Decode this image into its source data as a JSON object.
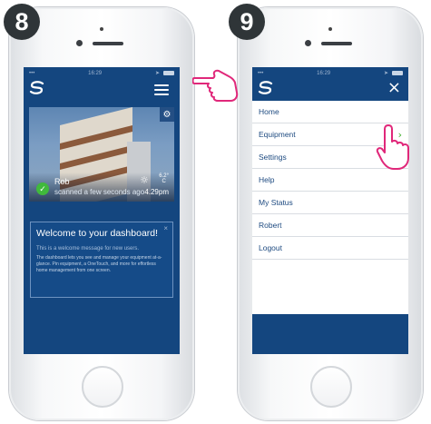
{
  "steps": {
    "left": "8",
    "right": "9"
  },
  "status_bar": {
    "left": "•••",
    "time": "16:29",
    "arrow": "➤"
  },
  "dashboard": {
    "user_name": "Rob",
    "scan_status": "scanned a few seconds ago",
    "temperature": "6.2°",
    "temperature_unit": "C",
    "time": "4.29pm",
    "welcome": {
      "title": "Welcome to your dashboard!",
      "close": "×",
      "message": "This is a welcome message for new users.",
      "description": "The dashboard lets you see and manage your equipment at-a-glance. Pin equipment, a OneTouch, and more for effortless home management from one screen."
    }
  },
  "menu": {
    "close": "×",
    "items": [
      "Home",
      "Equipment",
      "Settings",
      "Help",
      "My Status",
      "Robert",
      "Logout"
    ],
    "highlighted_item": "Equipment"
  },
  "icons": {
    "logo": "logo-icon",
    "menu": "hamburger-menu-icon",
    "settings": "gear-icon",
    "weather": "sun-icon",
    "check": "check-circle-icon",
    "chevron": "chevron-right-icon",
    "pointer": "hand-pointer-icon"
  },
  "colors": {
    "app_blue": "#14467f",
    "accent_green": "#40b93c",
    "menu_text": "#1d4a80",
    "badge": "#2f3538",
    "hand_outline": "#e0287a"
  }
}
